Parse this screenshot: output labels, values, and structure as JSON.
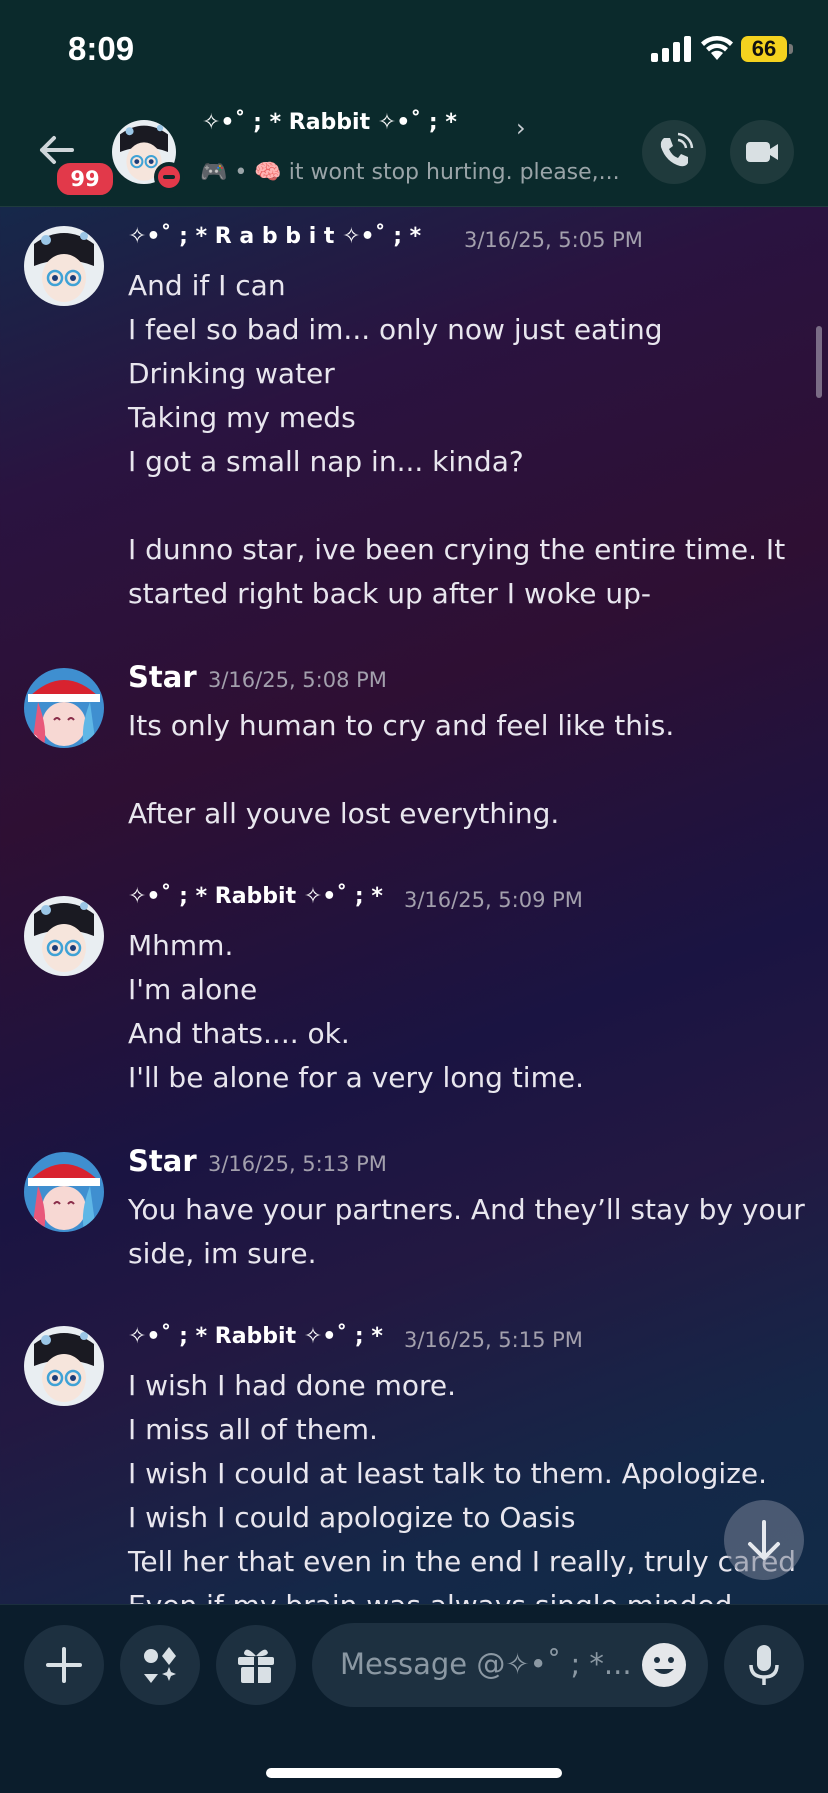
{
  "status_bar": {
    "time": "8:09",
    "battery": "66"
  },
  "header": {
    "unread_badge": "99",
    "name": "✧•˚ ; * Rabbit ✧•˚ ; *",
    "status_text": "• 🧠 it wont stop hurting. please,..."
  },
  "messages": [
    {
      "author": "✧•˚ ; * R a b b i t ✧•˚ ; *",
      "timestamp": "3/16/25, 5:05 PM",
      "lines": "And if I can\nI feel so bad im... only now just eating\nDrinking water\nTaking my meds\nI got a small nap in... kinda?\n\nI dunno star, ive been crying the entire time. It started right back up after I woke up-"
    },
    {
      "author": "Star",
      "timestamp": "3/16/25, 5:08 PM",
      "lines": "Its only human to cry and feel like this.\n\nAfter all youve lost everything."
    },
    {
      "author": "✧•˚ ; * Rabbit ✧•˚ ; *",
      "timestamp": "3/16/25, 5:09 PM",
      "lines": "Mhmm.\nI'm alone\nAnd thats.... ok.\nI'll be alone for a very long time."
    },
    {
      "author": "Star",
      "timestamp": "3/16/25, 5:13 PM",
      "lines": "You have your partners. And they’ll stay by your side, im sure."
    },
    {
      "author": "✧•˚ ; * Rabbit ✧•˚ ; *",
      "timestamp": "3/16/25, 5:15 PM",
      "lines": "I wish I had done more.\nI miss all of them.\nI wish I could at least talk to them. Apologize.\nI wish I could apologize to Oasis\nTell her that even in the end I really, truly cared\nEven if my brain was always single minded"
    }
  ],
  "composer": {
    "placeholder": "Message @✧•˚ ; *..."
  }
}
